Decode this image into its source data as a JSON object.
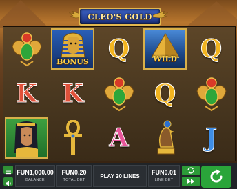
{
  "game": {
    "title": "CLEO'S GOLD"
  },
  "reels": [
    [
      {
        "symbol": "scarab",
        "icon": "green-scarab-icon"
      },
      {
        "symbol": "K"
      },
      {
        "symbol": "cleopatra",
        "icon": "cleopatra-icon"
      }
    ],
    [
      {
        "symbol": "bonus",
        "label": "BONUS",
        "icon": "pharaoh-mask-icon"
      },
      {
        "symbol": "K"
      },
      {
        "symbol": "ankh",
        "icon": "ankh-icon"
      }
    ],
    [
      {
        "symbol": "Q"
      },
      {
        "symbol": "scarab",
        "icon": "green-scarab-icon"
      },
      {
        "symbol": "A"
      }
    ],
    [
      {
        "symbol": "wild",
        "label": "WILD",
        "icon": "pyramid-icon"
      },
      {
        "symbol": "Q"
      },
      {
        "symbol": "falcon",
        "icon": "falcon-statue-icon"
      }
    ],
    [
      {
        "symbol": "Q"
      },
      {
        "symbol": "scarab",
        "icon": "green-scarab-icon"
      },
      {
        "symbol": "J"
      }
    ]
  ],
  "bar": {
    "balance_value": "FUN1,000.00",
    "balance_label": "BALANCE",
    "total_bet_value": "FUN0.20",
    "total_bet_label": "TOTAL BET",
    "play_lines_label": "PLAY 20 LINES",
    "line_bet_value": "FUN0.01",
    "line_bet_label": "LINE BET"
  },
  "colors": {
    "spin_green": "#2aa53a",
    "bar_bg": "#202428",
    "letter_K": "#e0513a",
    "letter_Q": "#f2b420",
    "letter_A": "#e8569a",
    "letter_J": "#3f8ee6"
  }
}
